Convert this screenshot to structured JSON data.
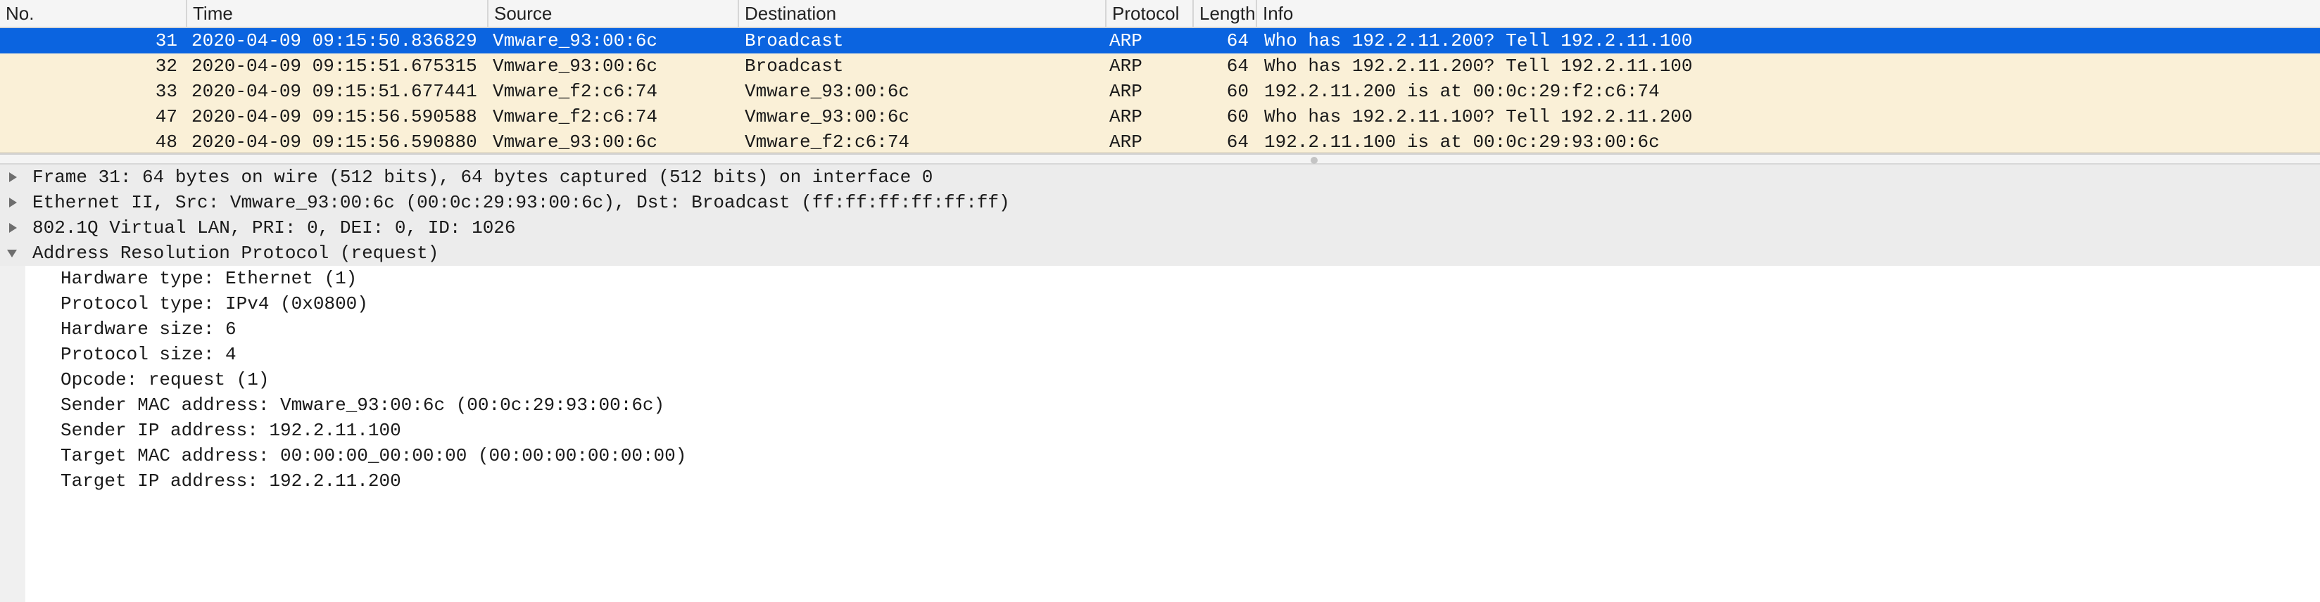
{
  "packet_list": {
    "columns": [
      "No.",
      "Time",
      "Source",
      "Destination",
      "Protocol",
      "Length",
      "Info"
    ],
    "selected_index": 0,
    "rows": [
      {
        "no": "31",
        "time": "2020-04-09 09:15:50.836829",
        "source": "Vmware_93:00:6c",
        "destination": "Broadcast",
        "protocol": "ARP",
        "length": "64",
        "info": "Who has 192.2.11.200? Tell 192.2.11.100"
      },
      {
        "no": "32",
        "time": "2020-04-09 09:15:51.675315",
        "source": "Vmware_93:00:6c",
        "destination": "Broadcast",
        "protocol": "ARP",
        "length": "64",
        "info": "Who has 192.2.11.200? Tell 192.2.11.100"
      },
      {
        "no": "33",
        "time": "2020-04-09 09:15:51.677441",
        "source": "Vmware_f2:c6:74",
        "destination": "Vmware_93:00:6c",
        "protocol": "ARP",
        "length": "60",
        "info": "192.2.11.200 is at 00:0c:29:f2:c6:74"
      },
      {
        "no": "47",
        "time": "2020-04-09 09:15:56.590588",
        "source": "Vmware_f2:c6:74",
        "destination": "Vmware_93:00:6c",
        "protocol": "ARP",
        "length": "60",
        "info": "Who has 192.2.11.100? Tell 192.2.11.200"
      },
      {
        "no": "48",
        "time": "2020-04-09 09:15:56.590880",
        "source": "Vmware_93:00:6c",
        "destination": "Vmware_f2:c6:74",
        "protocol": "ARP",
        "length": "64",
        "info": "192.2.11.100 is at 00:0c:29:93:00:6c"
      }
    ]
  },
  "packet_details": {
    "tree": [
      {
        "text": "Frame 31: 64 bytes on wire (512 bits), 64 bytes captured (512 bits) on interface 0",
        "expanded": false,
        "arrow_icon": "disclosure-right-icon"
      },
      {
        "text": "Ethernet II, Src: Vmware_93:00:6c (00:0c:29:93:00:6c), Dst: Broadcast (ff:ff:ff:ff:ff:ff)",
        "expanded": false,
        "arrow_icon": "disclosure-right-icon"
      },
      {
        "text": "802.1Q Virtual LAN, PRI: 0, DEI: 0, ID: 1026",
        "expanded": false,
        "arrow_icon": "disclosure-right-icon"
      },
      {
        "text": "Address Resolution Protocol (request)",
        "expanded": true,
        "arrow_icon": "disclosure-down-icon",
        "children": [
          "Hardware type: Ethernet (1)",
          "Protocol type: IPv4 (0x0800)",
          "Hardware size: 6",
          "Protocol size: 4",
          "Opcode: request (1)",
          "Sender MAC address: Vmware_93:00:6c (00:0c:29:93:00:6c)",
          "Sender IP address: 192.2.11.100",
          "Target MAC address: 00:00:00_00:00:00 (00:00:00:00:00:00)",
          "Target IP address: 192.2.11.200"
        ]
      }
    ]
  },
  "colors": {
    "selected_row": "#0b64e0",
    "arp_row": "#faf0d7",
    "header_bg": "#f5f5f5",
    "tree_top_bg": "#ececec"
  }
}
